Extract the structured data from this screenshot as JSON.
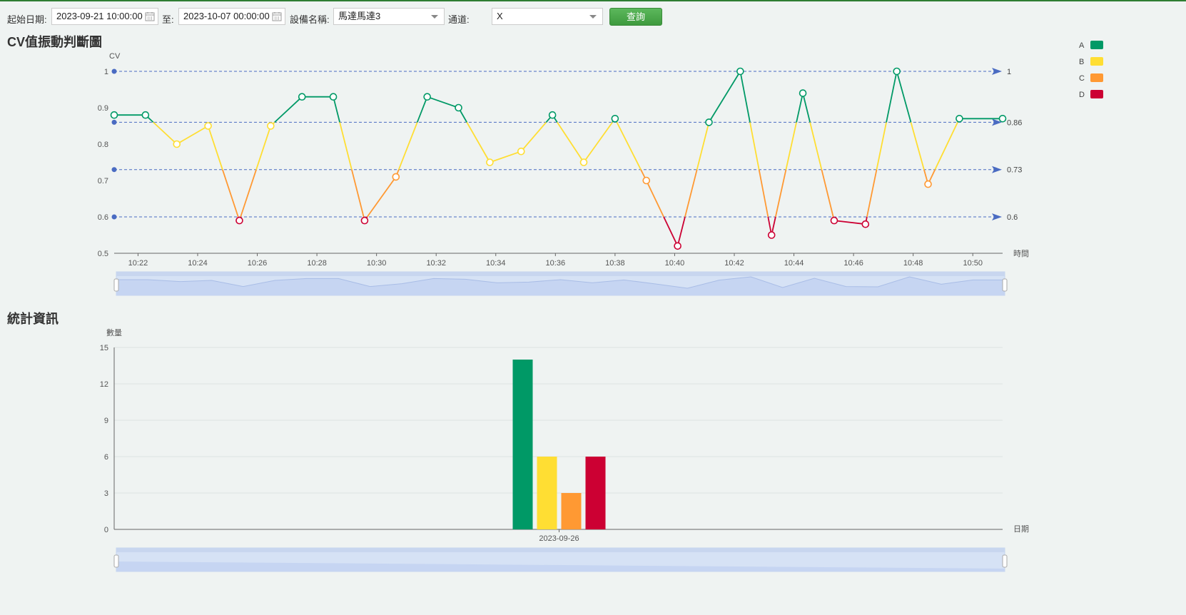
{
  "toolbar": {
    "start_label": "起始日期:",
    "start_value": "2023-09-21 10:00:00",
    "to_label": "至:",
    "end_value": "2023-10-07 00:00:00",
    "device_label": "設備名稱:",
    "device_value": "馬達馬達3",
    "channel_label": "通道:",
    "channel_value": "X",
    "query_label": "查詢"
  },
  "section1_title": "CV值振動判斷圖",
  "section2_title": "統計資訊",
  "legend": [
    {
      "name": "A",
      "color": "#009966"
    },
    {
      "name": "B",
      "color": "#ffde33"
    },
    {
      "name": "C",
      "color": "#ff9933"
    },
    {
      "name": "D",
      "color": "#cc0033"
    }
  ],
  "chart_data": [
    {
      "type": "line",
      "title": "",
      "ylabel": "CV",
      "xlabel": "時間",
      "ylim": [
        0.5,
        1
      ],
      "yticks": [
        "0.5",
        "0.6",
        "0.7",
        "0.8",
        "0.9",
        "1"
      ],
      "xlim_minutes": [
        21.2,
        51.0
      ],
      "xticks": [
        "10:22",
        "10:24",
        "10:26",
        "10:28",
        "10:30",
        "10:32",
        "10:34",
        "10:36",
        "10:38",
        "10:40",
        "10:42",
        "10:44",
        "10:46",
        "10:48",
        "10:50"
      ],
      "thresholds": [
        {
          "value": 1,
          "label": "1"
        },
        {
          "value": 0.86,
          "label": "0.86"
        },
        {
          "value": 0.73,
          "label": "0.73"
        },
        {
          "value": 0.6,
          "label": "0.6"
        }
      ],
      "series": [
        {
          "x_minutes": [
            21.2,
            22.25,
            23.3,
            24.35,
            25.4,
            26.45,
            27.5,
            28.55,
            29.6,
            30.65,
            31.7,
            32.75,
            33.8,
            34.85,
            35.9,
            36.95,
            38.0,
            39.05,
            40.1,
            41.15,
            42.2,
            43.25,
            44.3,
            45.35,
            46.4,
            47.45,
            48.5,
            49.55,
            51.0
          ],
          "values": [
            0.88,
            0.88,
            0.8,
            0.85,
            0.59,
            0.85,
            0.93,
            0.93,
            0.59,
            0.71,
            0.93,
            0.9,
            0.75,
            0.78,
            0.88,
            0.75,
            0.87,
            0.7,
            0.52,
            0.86,
            1.0,
            0.55,
            0.94,
            0.59,
            0.58,
            1.0,
            0.69,
            0.87,
            0.87
          ]
        }
      ],
      "visual_map": [
        {
          "range": [
            0.86,
            1.0
          ],
          "level": "A",
          "color": "#009966"
        },
        {
          "range": [
            0.73,
            0.86
          ],
          "level": "B",
          "color": "#ffde33"
        },
        {
          "range": [
            0.6,
            0.73
          ],
          "level": "C",
          "color": "#ff9933"
        },
        {
          "range": [
            0.5,
            0.6
          ],
          "level": "D",
          "color": "#cc0033"
        }
      ]
    },
    {
      "type": "bar",
      "title": "",
      "ylabel": "數量",
      "xlabel": "日期",
      "ylim": [
        0,
        15
      ],
      "yticks": [
        "0",
        "3",
        "6",
        "9",
        "12",
        "15"
      ],
      "categories": [
        "2023-09-26"
      ],
      "series": [
        {
          "name": "A",
          "color": "#009966",
          "values": [
            14
          ]
        },
        {
          "name": "B",
          "color": "#ffde33",
          "values": [
            6
          ]
        },
        {
          "name": "C",
          "color": "#ff9933",
          "values": [
            3
          ]
        },
        {
          "name": "D",
          "color": "#cc0033",
          "values": [
            6
          ]
        }
      ]
    }
  ]
}
